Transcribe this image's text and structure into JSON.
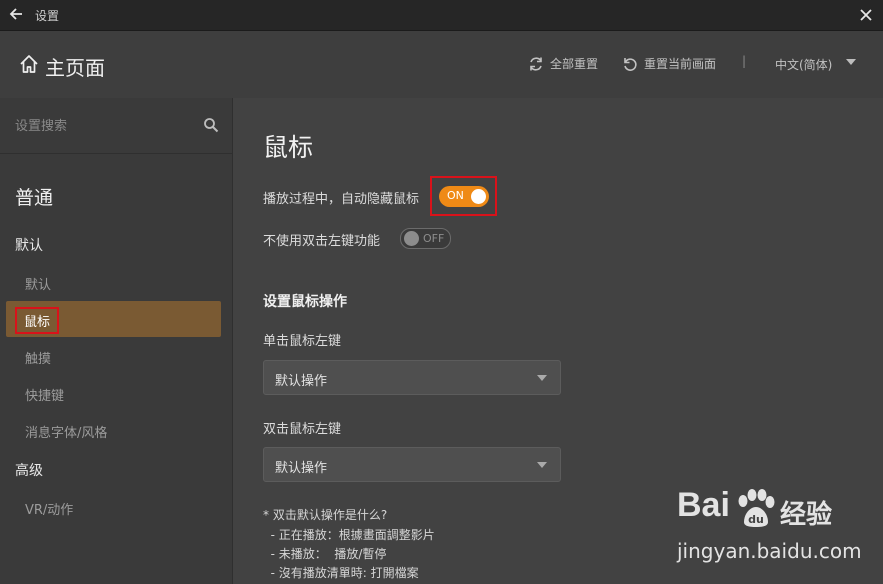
{
  "window": {
    "title": "设置"
  },
  "header": {
    "title": "主页面",
    "reset_all": "全部重置",
    "reset_current": "重置当前画面",
    "separator": "|",
    "language": "中文(简体)"
  },
  "sidebar": {
    "search_placeholder": "设置搜索",
    "section": "普通",
    "groups": [
      {
        "label": "默认",
        "items": [
          "默认",
          "鼠标",
          "触摸",
          "快捷键",
          "消息字体/风格"
        ]
      },
      {
        "label": "高级",
        "items": [
          "VR/动作"
        ]
      }
    ],
    "active_item": "鼠标"
  },
  "main": {
    "title": "鼠标",
    "options": [
      {
        "label": "播放过程中，自动隐藏鼠标",
        "toggle": "ON",
        "state": true
      },
      {
        "label": "不使用双击左键功能",
        "toggle": "OFF",
        "state": false
      }
    ],
    "section_title": "设置鼠标操作",
    "single_click_label": "单击鼠标左键",
    "single_click_value": "默认操作",
    "double_click_label": "双击鼠标左键",
    "double_click_value": "默认操作",
    "note_lines": [
      "* 双击默认操作是什么?",
      "  - 正在播放：根據畫面調整影片",
      "  - 未播放：  播放/暫停",
      "  - 沒有播放清單時: 打開檔案"
    ]
  },
  "watermark": {
    "logo": "Bai",
    "logo_cn": "经验",
    "url": "jingyan.baidu.com"
  },
  "colors": {
    "accent": "#ef8a16",
    "active_bg": "#7a5a33",
    "highlight": "#d9121a"
  }
}
